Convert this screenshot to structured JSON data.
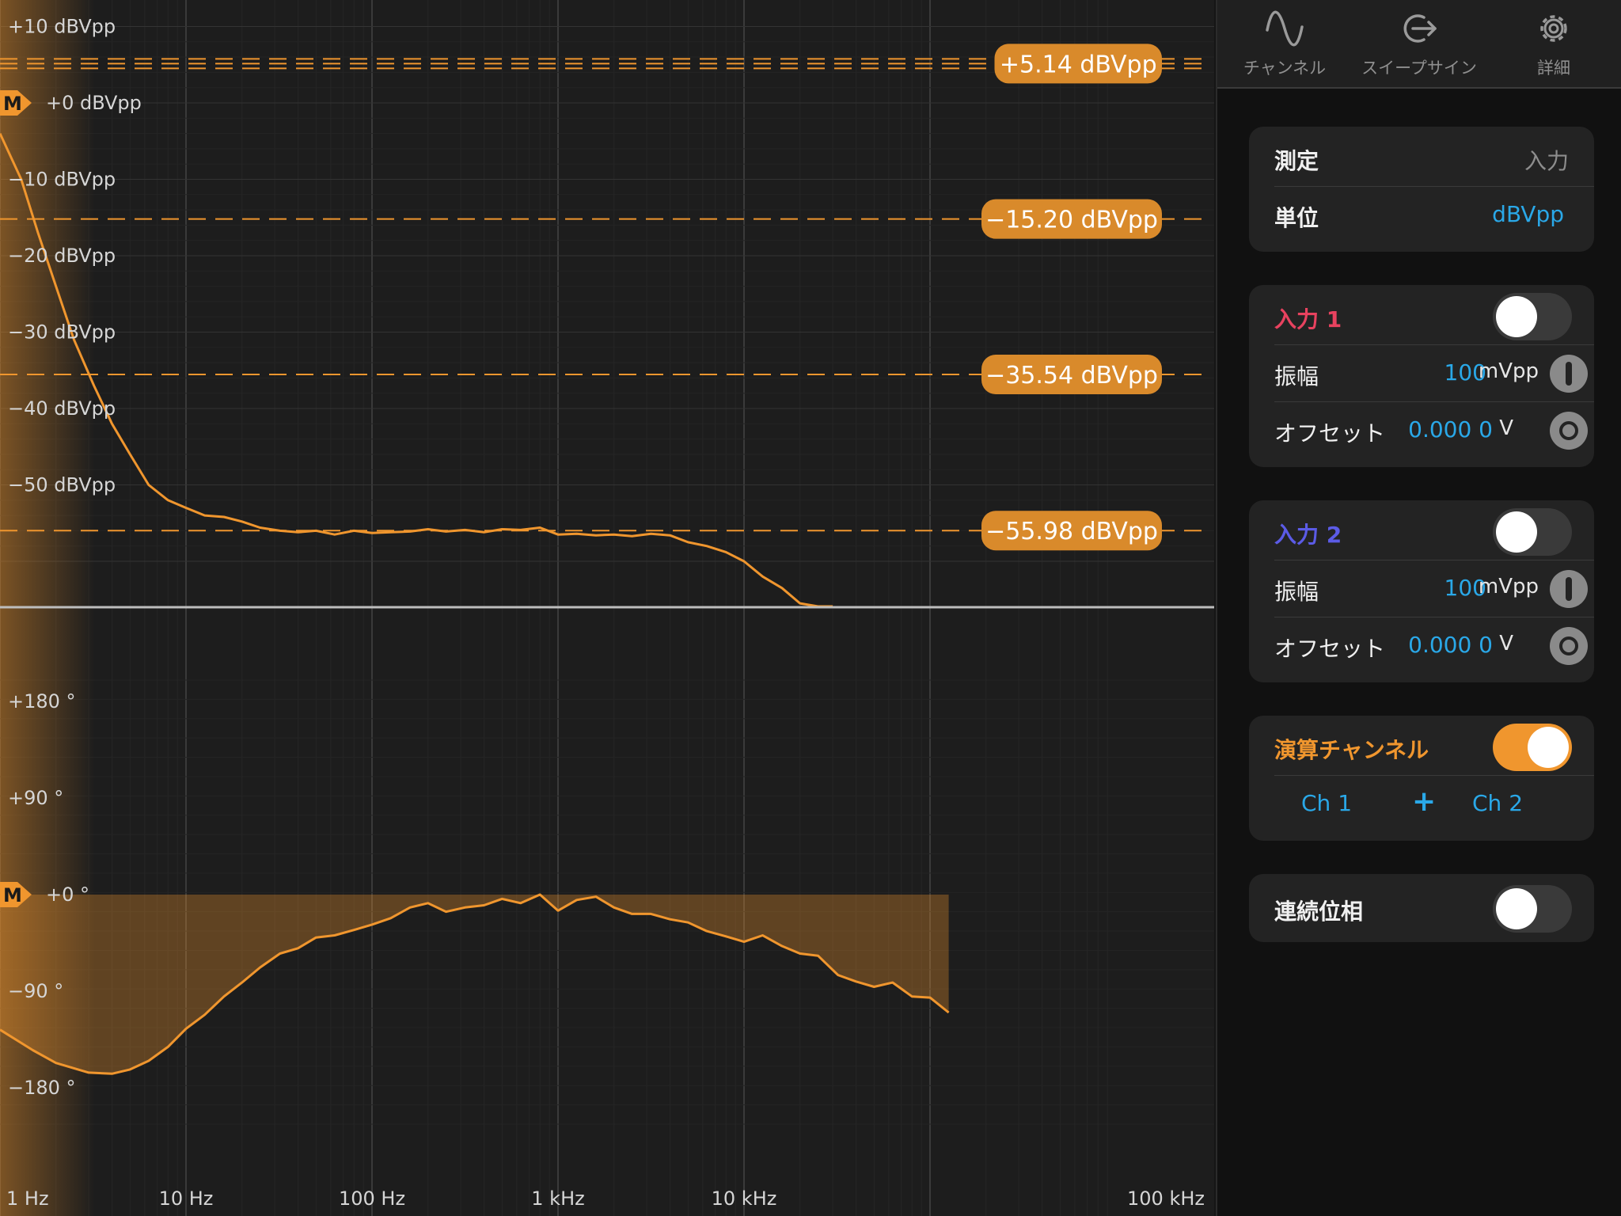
{
  "plot": {
    "magnitude_axis": [
      "+10 dBVpp",
      "+0 dBVpp",
      "−10 dBVpp",
      "−20 dBVpp",
      "−30 dBVpp",
      "−40 dBVpp",
      "−50 dBVpp"
    ],
    "phase_axis": [
      "+180 °",
      "+90 °",
      "+0 °",
      "−90 °",
      "−180 °"
    ],
    "frequency_axis": [
      "1 Hz",
      "10 Hz",
      "100 Hz",
      "1 kHz",
      "10 kHz",
      "100 kHz"
    ],
    "marker_label": "M",
    "cursors": [
      {
        "label": "+5.14 dBVpp",
        "value": 5.14
      },
      {
        "label": "−15.20 dBVpp",
        "value": -15.2
      },
      {
        "label": "−35.54 dBVpp",
        "value": -35.54
      },
      {
        "label": "−55.98 dBVpp",
        "value": -55.98
      }
    ],
    "colors": {
      "trace": "#f0962e",
      "cursor_fill": "#d98a2b",
      "grid": "#2f2f2f"
    },
    "magnitude_trace": {
      "freq_hz": [
        1,
        1.3,
        1.6,
        2,
        2.5,
        3.2,
        4,
        5,
        6.3,
        8,
        10,
        12.6,
        16,
        20,
        25,
        32,
        40,
        50,
        63,
        80,
        100,
        126,
        160,
        200,
        250,
        316,
        400,
        500,
        630,
        800,
        1000,
        1260,
        1600,
        2000,
        2500,
        3160,
        4000,
        5000,
        6300,
        8000,
        10000,
        12600,
        16000,
        20000,
        25000,
        30000
      ],
      "dbvpp": [
        -4,
        -10,
        -17,
        -24,
        -31,
        -37,
        -42,
        -46,
        -50,
        -52,
        -53,
        -54,
        -54.2,
        -54.8,
        -55.6,
        -56,
        -56.2,
        -56,
        -56.5,
        -56,
        -56.3,
        -56.2,
        -56.1,
        -55.8,
        -56.1,
        -55.9,
        -56.2,
        -55.8,
        -55.9,
        -55.6,
        -56.5,
        -56.4,
        -56.6,
        -56.5,
        -56.7,
        -56.4,
        -56.6,
        -57.5,
        -58,
        -58.8,
        -60,
        -62,
        -63.5,
        -65.5,
        -67,
        -68
      ]
    },
    "phase_trace": {
      "freq_hz": [
        1,
        1.5,
        2,
        3,
        4,
        5,
        6.3,
        8,
        10,
        12.6,
        16,
        20,
        25,
        32,
        40,
        50,
        63,
        80,
        100,
        126,
        160,
        200,
        250,
        316,
        400,
        500,
        630,
        800,
        1000,
        1260,
        1600,
        2000,
        2500,
        3160,
        4000,
        5000,
        6300,
        8000,
        10000,
        12600,
        16000,
        20000,
        25000,
        32000,
        40000,
        50000,
        63000,
        80000,
        100000,
        126000
      ],
      "deg": [
        -126,
        -145,
        -157,
        -166,
        -167,
        -163,
        -155,
        -142,
        -125,
        -112,
        -95,
        -82,
        -68,
        -55,
        -50,
        -40,
        -38,
        -33,
        -28,
        -22,
        -12,
        -8,
        -16,
        -12,
        -10,
        -4,
        -8,
        0,
        -15,
        -5,
        -2,
        -12,
        -18,
        -18,
        -23,
        -26,
        -34,
        -39,
        -44,
        -38,
        -48,
        -55,
        -57,
        -75,
        -81,
        -86,
        -82,
        -95,
        -96,
        -110
      ]
    }
  },
  "tabs": [
    {
      "label": "チャンネル",
      "icon": "sine-wave-icon"
    },
    {
      "label": "スイープサイン",
      "icon": "sweep-out-icon"
    },
    {
      "label": "詳細",
      "icon": "gear-icon"
    }
  ],
  "measure_card": {
    "measure_label": "測定",
    "measure_value": "入力",
    "unit_label": "単位",
    "unit_value": "dBVpp"
  },
  "input1": {
    "title": "入力 1",
    "color": "#e8425f",
    "enabled": false,
    "amplitude_label": "振幅",
    "amplitude_value": "100",
    "amplitude_unit": "mVpp",
    "offset_label": "オフセット",
    "offset_value": "0.000 0",
    "offset_unit": "V"
  },
  "input2": {
    "title": "入力 2",
    "color": "#5b5be6",
    "enabled": false,
    "amplitude_label": "振幅",
    "amplitude_value": "100",
    "amplitude_unit": "mVpp",
    "offset_label": "オフセット",
    "offset_value": "0.000 0",
    "offset_unit": "V"
  },
  "math_channel": {
    "title": "演算チャンネル",
    "color": "#f0962e",
    "enabled": true,
    "operand_a": "Ch 1",
    "operator": "+",
    "operand_b": "Ch 2"
  },
  "continuous_phase": {
    "label": "連続位相",
    "enabled": false
  },
  "accent_blue": "#2aa8e8"
}
